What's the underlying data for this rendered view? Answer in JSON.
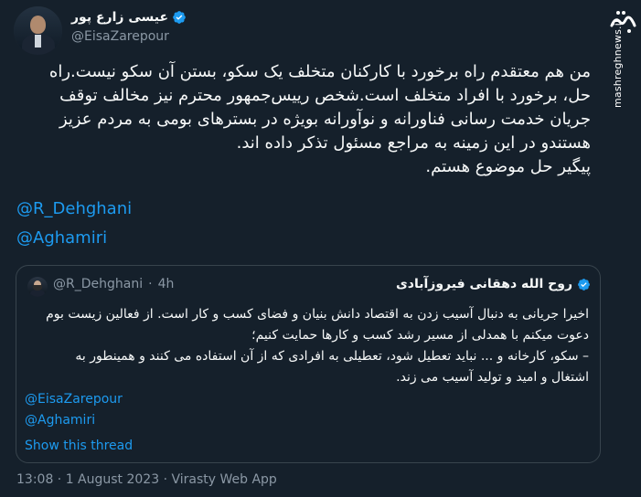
{
  "author": {
    "display_name": "عیسی زارع پور",
    "handle": "@EisaZarepour"
  },
  "watermark": {
    "logo_text": "مشرق",
    "site": "mashreghnews.ir"
  },
  "tweet": {
    "lines": [
      "من هم معتقدم راه برخورد با کارکنان متخلف یک سکو، بستن آن سکو نیست.راه",
      "حل، برخورد با افراد متخلف است.شخص رییس‌جمهور محترم نیز مخالف توقف",
      "جریان خدمت رسانی فناورانه و نوآورانه بویژه در بسترهای بومی به مردم عزیز",
      "هستندو در این زمینه به مراجع مسئول تذکر داده اند.",
      "پیگیر حل موضوع هستم."
    ],
    "mentions": [
      "@R_Dehghani",
      "@Aghamiri"
    ]
  },
  "quoted": {
    "display_name": "روح الله دهقانی فیروزآبادی",
    "handle": "@R_Dehghani",
    "separator": "·",
    "time": "4h",
    "lines": [
      "اخیرا جریانی به دنبال آسیب زدن به اقتصاد دانش بنیان و فضای کسب و کار است. از فعالین زیست بوم",
      "دعوت میکنم با همدلی از مسیر رشد کسب و کارها حمایت کنیم؛",
      "– سکو، کارخانه و ... نباید تعطیل شود، تعطیلی به افرادی که از آن استفاده می کنند و همینطور به",
      "اشتغال و امید و تولید آسیب می زند."
    ],
    "mentions": [
      "@EisaZarepour",
      "@Aghamiri"
    ],
    "show_thread": "Show this thread"
  },
  "meta": {
    "text": "13:08 · 1 August 2023 · Virasty Web App"
  },
  "colors": {
    "background": "#15202b",
    "link": "#1d9bf0",
    "muted": "#8b98a5",
    "border": "#38444d"
  }
}
